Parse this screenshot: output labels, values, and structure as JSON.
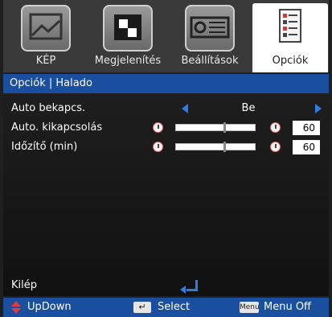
{
  "tabs": [
    {
      "label": "KÉP",
      "icon": "picture-icon",
      "active": false
    },
    {
      "label": "Megjelenítés",
      "icon": "display-icon",
      "active": false
    },
    {
      "label": "Beállítások",
      "icon": "projector-icon",
      "active": false
    },
    {
      "label": "Opciók",
      "icon": "options-list-icon",
      "active": true
    }
  ],
  "breadcrumb": "Opciók | Halado",
  "rows": {
    "auto_power_on": {
      "label": "Auto bekapcs.",
      "value": "Be"
    },
    "auto_power_off": {
      "label": "Auto. kikapcsolás",
      "value": "60",
      "slider_fraction": 0.6
    },
    "sleep_timer": {
      "label": "Időzítő (min)",
      "value": "60",
      "slider_fraction": 0.6
    }
  },
  "exit": {
    "label": "Kilép"
  },
  "footer": {
    "updown_label": "UpDown",
    "select_label": "Select",
    "menu_key": "Menu",
    "menu_off_label": "Menu Off"
  },
  "colors": {
    "accent_blue": "#1a4fa0",
    "arrow_blue": "#2f7de1",
    "updown_red": "#e23b3b"
  }
}
